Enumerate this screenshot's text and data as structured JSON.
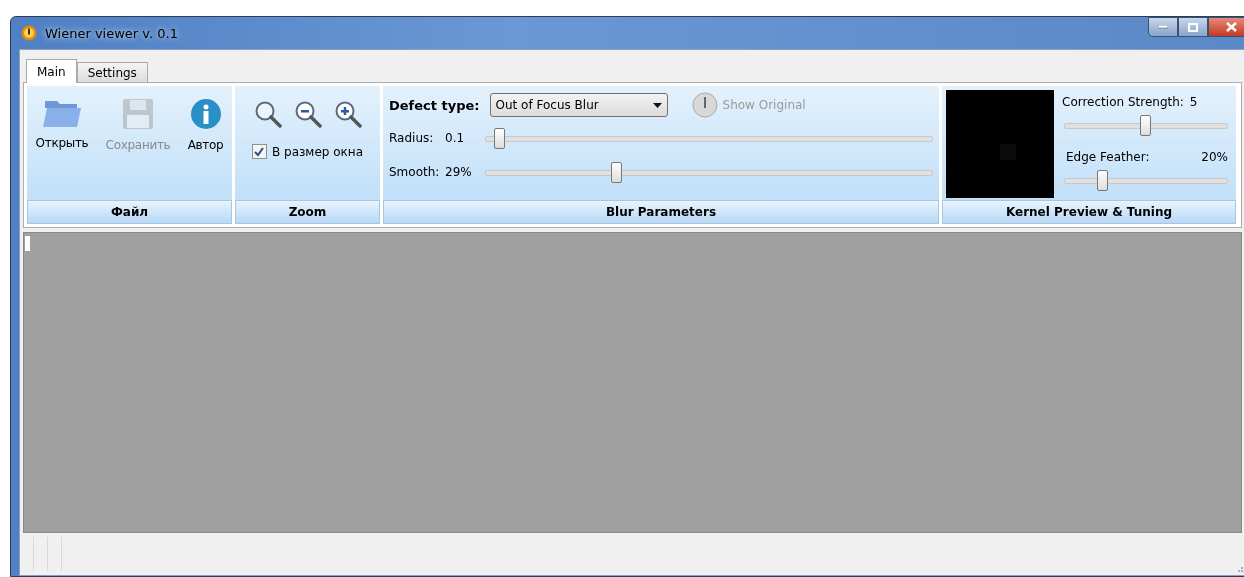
{
  "window": {
    "title": "Wiener viewer v. 0.1"
  },
  "tabs": [
    {
      "label": "Main",
      "selected": true
    },
    {
      "label": "Settings",
      "selected": false
    }
  ],
  "file_group": {
    "title": "Файл",
    "buttons": [
      {
        "kind": "open",
        "label": "Открыть",
        "disabled": false
      },
      {
        "kind": "save",
        "label": "Сохранить",
        "disabled": true
      },
      {
        "kind": "about",
        "label": "Автор",
        "disabled": false
      }
    ]
  },
  "zoom_group": {
    "title": "Zoom",
    "buttons": [
      {
        "kind": "fit"
      },
      {
        "kind": "out"
      },
      {
        "kind": "in"
      }
    ],
    "fit_checkbox": {
      "label": "В размер окна",
      "checked": true
    }
  },
  "blur_group": {
    "title": "Blur Parameters",
    "defect_type": {
      "label": "Defect type:",
      "value": "Out of Focus Blur"
    },
    "show_original": {
      "label": "Show Original",
      "disabled": true
    },
    "sliders": [
      {
        "label": "Radius:",
        "reading": "0.1",
        "level": 0.02
      },
      {
        "label": "Smooth:",
        "reading": "29%",
        "level": 0.29
      }
    ]
  },
  "kernel_group": {
    "title": "Kernel Preview & Tuning",
    "sliders": [
      {
        "label": "Correction Strength:",
        "reading": "5",
        "level": 0.5
      },
      {
        "label": "Edge Feather:",
        "reading": "20%",
        "level": 0.22
      }
    ]
  }
}
